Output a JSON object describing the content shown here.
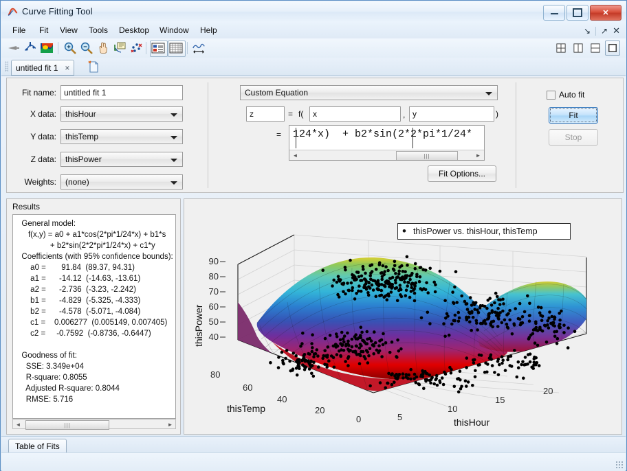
{
  "window": {
    "title": "Curve Fitting Tool",
    "icon": "matlab-curve-icon",
    "minimize_label": "Minimize",
    "maximize_label": "Maximize",
    "close_label": "✕"
  },
  "menu": {
    "items": [
      {
        "label": "File",
        "mnemonic": "F"
      },
      {
        "label": "Fit",
        "mnemonic": "i"
      },
      {
        "label": "View",
        "mnemonic": "V"
      },
      {
        "label": "Tools",
        "mnemonic": "T"
      },
      {
        "label": "Desktop",
        "mnemonic": "D"
      },
      {
        "label": "Window",
        "mnemonic": "W"
      },
      {
        "label": "Help",
        "mnemonic": "H"
      }
    ],
    "right_icons": [
      "dock-icon",
      "undock-icon",
      "close-icon"
    ]
  },
  "toolbar": {
    "icons": [
      "fit-arrow-icon",
      "exclude-outliers-icon",
      "colormap-surface-icon",
      "zoom-in-icon",
      "zoom-out-icon",
      "pan-icon",
      "data-cursor-icon",
      "exclude-points-icon",
      "legend-toggle-icon",
      "grid-toggle-icon",
      "axes-limits-icon"
    ],
    "layout_icons": [
      "layout-quad-icon",
      "layout-vertical-icon",
      "layout-horizontal-icon",
      "layout-single-icon"
    ],
    "layout_selected": "layout-single-icon"
  },
  "fit_tabs": {
    "tabs": [
      {
        "label": "untitled fit 1",
        "close": "×"
      }
    ],
    "new_fit_icon": "new-fit-icon"
  },
  "config": {
    "fit_name": {
      "label": "Fit name:",
      "value": "untitled fit 1"
    },
    "x_data": {
      "label": "X data:",
      "value": "thisHour"
    },
    "y_data": {
      "label": "Y data:",
      "value": "thisTemp"
    },
    "z_data": {
      "label": "Z data:",
      "value": "thisPower"
    },
    "weights": {
      "label": "Weights:",
      "value": "(none)"
    },
    "fit_type": {
      "value": "Custom Equation"
    },
    "equation_row": {
      "output": "z",
      "eq_sign": "=",
      "fn_open": "f(",
      "arg1": "x",
      "comma": ",",
      "arg2": "y",
      "fn_close": ")"
    },
    "equation_body": {
      "eq_sign": "=",
      "text": "124*x)  + b2*sin(2*2*pi*1/24*",
      "scroll_thumb_glyph": "|||",
      "scroll_left": "◄",
      "scroll_right": "►"
    },
    "fit_options_button": "Fit Options...",
    "auto_fit": {
      "label": "Auto fit",
      "checked": false
    },
    "fit_button": "Fit",
    "stop_button": "Stop"
  },
  "results": {
    "title": "Results",
    "text": "  General model:\n     f(x,y) = a0 + a1*cos(2*pi*1/24*x) + b1*s\n               + b2*sin(2*2*pi*1/24*x) + c1*y\n  Coefficients (with 95% confidence bounds):\n      a0 =       91.84  (89.37, 94.31)\n      a1 =      -14.12  (-14.63, -13.61)\n      a2 =      -2.736  (-3.23, -2.242)\n      b1 =      -4.829  (-5.325, -4.333)\n      b2 =      -4.578  (-5.071, -4.084)\n      c1 =    0.006277  (0.005149, 0.007405)\n      c2 =     -0.7592  (-0.8736, -0.6447)\n\n  Goodness of fit:\n    SSE: 3.349e+04\n    R-square: 0.8055\n    Adjusted R-square: 0.8044\n    RMSE: 5.716",
    "general_model_label": "General model:",
    "coefficients": [
      {
        "name": "a0",
        "value": "91.84",
        "ci": "(89.37, 94.31)"
      },
      {
        "name": "a1",
        "value": "-14.12",
        "ci": "(-14.63, -13.61)"
      },
      {
        "name": "a2",
        "value": "-2.736",
        "ci": "(-3.23, -2.242)"
      },
      {
        "name": "b1",
        "value": "-4.829",
        "ci": "(-5.325, -4.333)"
      },
      {
        "name": "b2",
        "value": "-4.578",
        "ci": "(-5.071, -4.084)"
      },
      {
        "name": "c1",
        "value": "0.006277",
        "ci": "(0.005149, 0.007405)"
      },
      {
        "name": "c2",
        "value": "-0.7592",
        "ci": "(-0.8736, -0.6447)"
      }
    ],
    "goodness": {
      "label": "Goodness of fit:",
      "sse": "SSE: 3.349e+04",
      "rsquare": "R-square: 0.8055",
      "adj_rsquare": "Adjusted R-square: 0.8044",
      "rmse": "RMSE: 5.716"
    },
    "scroll_thumb_glyph": "|||",
    "scroll_left": "◄",
    "scroll_right": "►"
  },
  "bottom": {
    "tab_label": "Table of Fits"
  },
  "chart_data": {
    "type": "scatter",
    "title": "",
    "legend_label": "thisPower vs. thisHour, thisTemp",
    "legend_marker": "•",
    "legend_position": "top-right",
    "xlabel": "thisHour",
    "ylabel": "thisTemp",
    "zlabel": "thisPower",
    "x_ticks": [
      "0",
      "5",
      "10",
      "15",
      "20"
    ],
    "y_ticks": [
      "80",
      "60",
      "40",
      "20",
      "0"
    ],
    "z_ticks": [
      "90",
      "80",
      "70",
      "60",
      "50",
      "40"
    ],
    "xlim": [
      0,
      24
    ],
    "ylim": [
      0,
      90
    ],
    "zlim": [
      35,
      95
    ],
    "grid": true,
    "surface_colormap": "jet",
    "marker_color": "#000000",
    "marker_count_approx": 700,
    "projection": "3d-perspective"
  }
}
